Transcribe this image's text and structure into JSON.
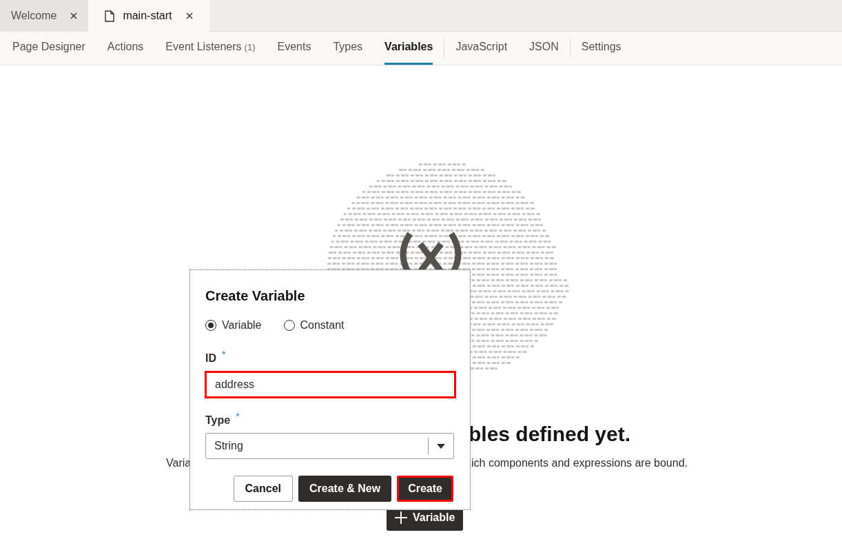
{
  "editor_tabs": [
    {
      "label": "Welcome",
      "selected": false,
      "file_icon": false
    },
    {
      "label": "main-start",
      "selected": true,
      "file_icon": true
    }
  ],
  "nav_tabs": [
    {
      "label": "Page Designer",
      "selected": false,
      "divider_after": false
    },
    {
      "label": "Actions",
      "selected": false,
      "divider_after": false
    },
    {
      "label": "Event Listeners",
      "count": "(1)",
      "selected": false,
      "divider_after": false
    },
    {
      "label": "Events",
      "selected": false,
      "divider_after": false
    },
    {
      "label": "Types",
      "selected": false,
      "divider_after": false
    },
    {
      "label": "Variables",
      "selected": true,
      "divider_after": true
    },
    {
      "label": "JavaScript",
      "selected": false,
      "divider_after": false
    },
    {
      "label": "JSON",
      "selected": false,
      "divider_after": true
    },
    {
      "label": "Settings",
      "selected": false,
      "divider_after": false
    }
  ],
  "empty_state": {
    "heading": "bles defined yet.",
    "description_start": "Varia",
    "description_end": "ich components and expressions are bound.",
    "add_button": "Variable"
  },
  "dialog": {
    "title": "Create Variable",
    "radios": [
      {
        "label": "Variable",
        "selected": true
      },
      {
        "label": "Constant",
        "selected": false
      }
    ],
    "id_field": {
      "label": "ID",
      "required_mark": "*",
      "value": "address",
      "highlighted": true
    },
    "type_field": {
      "label": "Type",
      "required_mark": "*",
      "value": "String"
    },
    "buttons": [
      {
        "label": "Cancel",
        "kind": "secondary",
        "highlighted": false
      },
      {
        "label": "Create & New",
        "kind": "primary",
        "highlighted": false
      },
      {
        "label": "Create",
        "kind": "primary",
        "highlighted": true
      }
    ]
  }
}
